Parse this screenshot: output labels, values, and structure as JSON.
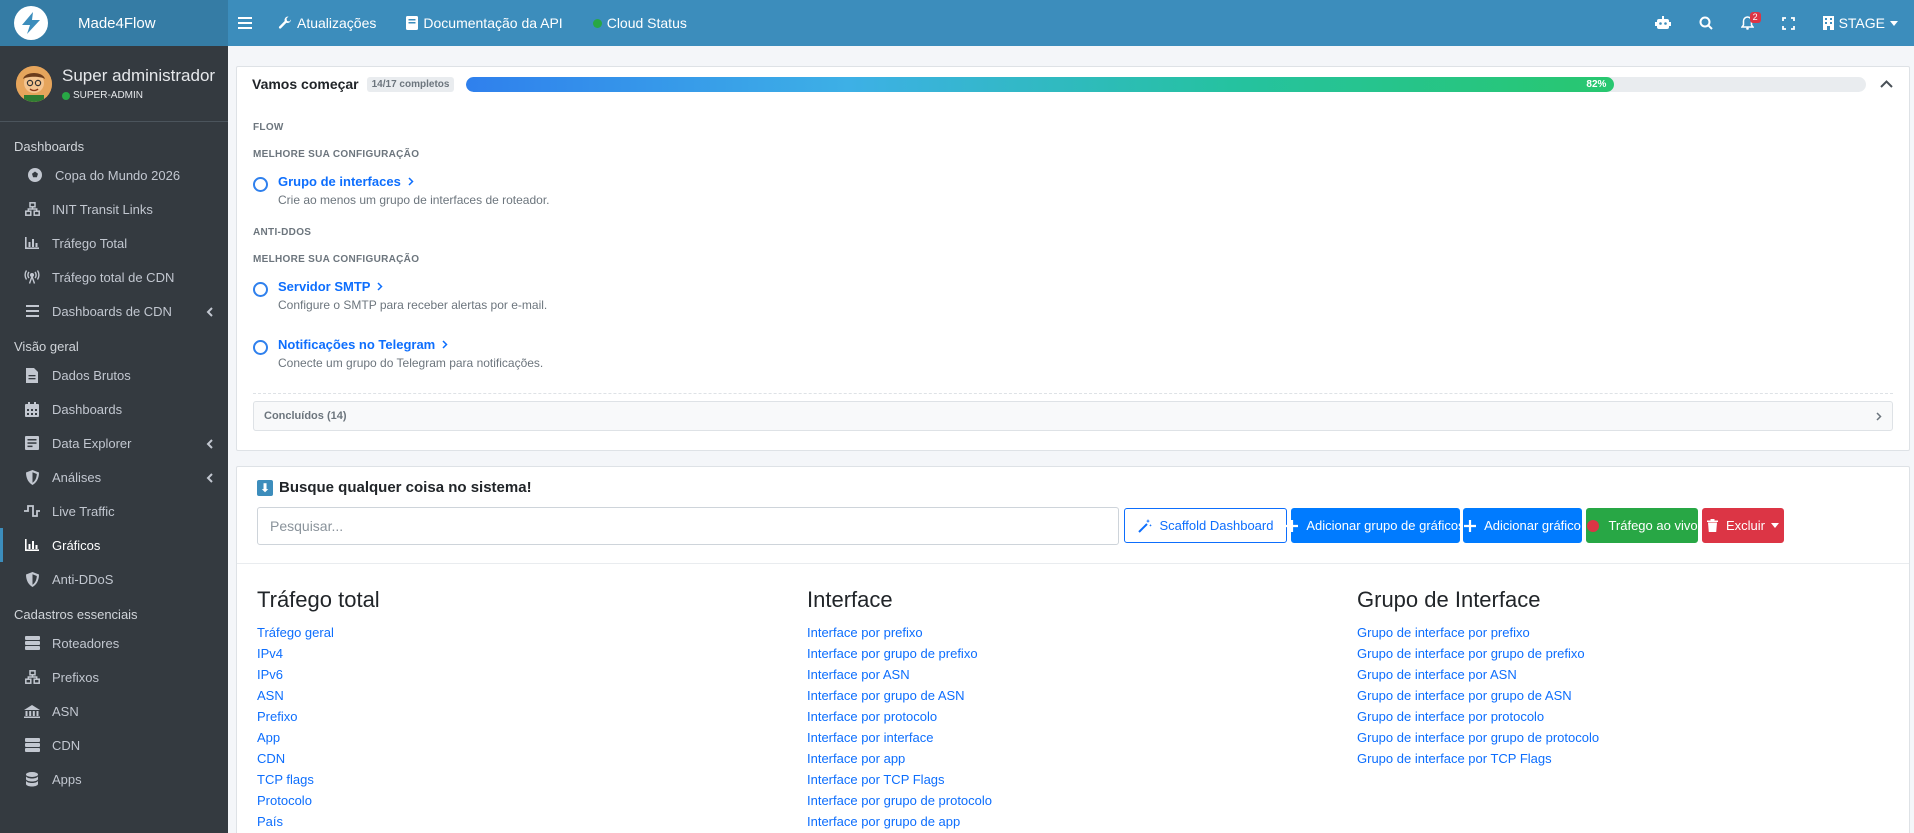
{
  "header": {
    "brand": "Made4Flow",
    "nav": [
      {
        "label": "Atualizações",
        "icon": "wrench-icon"
      },
      {
        "label": "Documentação da API",
        "icon": "book-icon"
      },
      {
        "label": "Cloud Status",
        "icon": "status-dot-icon"
      }
    ],
    "notifications_count": "2",
    "environment": "STAGE"
  },
  "sidebar": {
    "user_name": "Super administrador",
    "user_role": "SUPER-ADMIN",
    "sections": [
      {
        "title": "Dashboards",
        "items": [
          {
            "label": "Copa do Mundo 2026",
            "icon": "soccer-ball-icon"
          },
          {
            "label": "INIT Transit Links",
            "icon": "network-icon"
          },
          {
            "label": "Tráfego Total",
            "icon": "bar-chart-icon"
          },
          {
            "label": "Tráfego total de CDN",
            "icon": "broadcast-icon"
          },
          {
            "label": "Dashboards de CDN",
            "icon": "list-icon"
          }
        ]
      },
      {
        "title": "Visão geral",
        "items": [
          {
            "label": "Dados Brutos",
            "icon": "file-icon"
          },
          {
            "label": "Dashboards",
            "icon": "calendar-icon"
          },
          {
            "label": "Data Explorer",
            "icon": "document-icon"
          },
          {
            "label": "Análises",
            "icon": "shield-icon"
          },
          {
            "label": "Live Traffic",
            "icon": "pulse-icon"
          },
          {
            "label": "Gráficos",
            "icon": "bar-chart-icon"
          },
          {
            "label": "Anti-DDoS",
            "icon": "shield-icon"
          }
        ]
      },
      {
        "title": "Cadastros essenciais",
        "items": [
          {
            "label": "Roteadores",
            "icon": "server-icon"
          },
          {
            "label": "Prefixos",
            "icon": "network-icon"
          },
          {
            "label": "ASN",
            "icon": "building-icon"
          },
          {
            "label": "CDN",
            "icon": "server-icon"
          },
          {
            "label": "Apps",
            "icon": "database-icon"
          }
        ]
      }
    ]
  },
  "getting_started": {
    "title": "Vamos começar",
    "completed_badge": "14/17 completos",
    "progress": 82,
    "progress_label": "82%",
    "groups": [
      {
        "name": "FLOW",
        "subtitle": "MELHORE SUA CONFIGURAÇÃO",
        "tasks": [
          {
            "title": "Grupo de interfaces",
            "desc": "Crie ao menos um grupo de interfaces de roteador."
          }
        ]
      },
      {
        "name": "ANTI-DDOS",
        "subtitle": "MELHORE SUA CONFIGURAÇÃO",
        "tasks": [
          {
            "title": "Servidor SMTP",
            "desc": "Configure o SMTP para receber alertas por e-mail."
          },
          {
            "title": "Notificações no Telegram",
            "desc": "Conecte um grupo do Telegram para notificações."
          }
        ]
      }
    ],
    "completed_label": "Concluídos (14)"
  },
  "search_card": {
    "heading": "Busque qualquer coisa no sistema!",
    "placeholder": "Pesquisar...",
    "buttons": {
      "scaffold": "Scaffold Dashboard",
      "add_group": "Adicionar grupo de gráficos",
      "add_chart": "Adicionar gráfico",
      "live": "Tráfego ao vivo",
      "delete": "Excluir"
    },
    "columns": [
      {
        "title": "Tráfego total",
        "links": [
          "Tráfego geral",
          "IPv4",
          "IPv6",
          "ASN",
          "Prefixo",
          "App",
          "CDN",
          "TCP flags",
          "Protocolo",
          "País"
        ]
      },
      {
        "title": "Interface",
        "links": [
          "Interface por prefixo",
          "Interface por grupo de prefixo",
          "Interface por ASN",
          "Interface por grupo de ASN",
          "Interface por protocolo",
          "Interface por interface",
          "Interface por app",
          "Interface por TCP Flags",
          "Interface por grupo de protocolo",
          "Interface por grupo de app"
        ]
      },
      {
        "title": "Grupo de Interface",
        "links": [
          "Grupo de interface por prefixo",
          "Grupo de interface por grupo de prefixo",
          "Grupo de interface por ASN",
          "Grupo de interface por grupo de ASN",
          "Grupo de interface por protocolo",
          "Grupo de interface por grupo de protocolo",
          "Grupo de interface por TCP Flags"
        ]
      }
    ]
  }
}
